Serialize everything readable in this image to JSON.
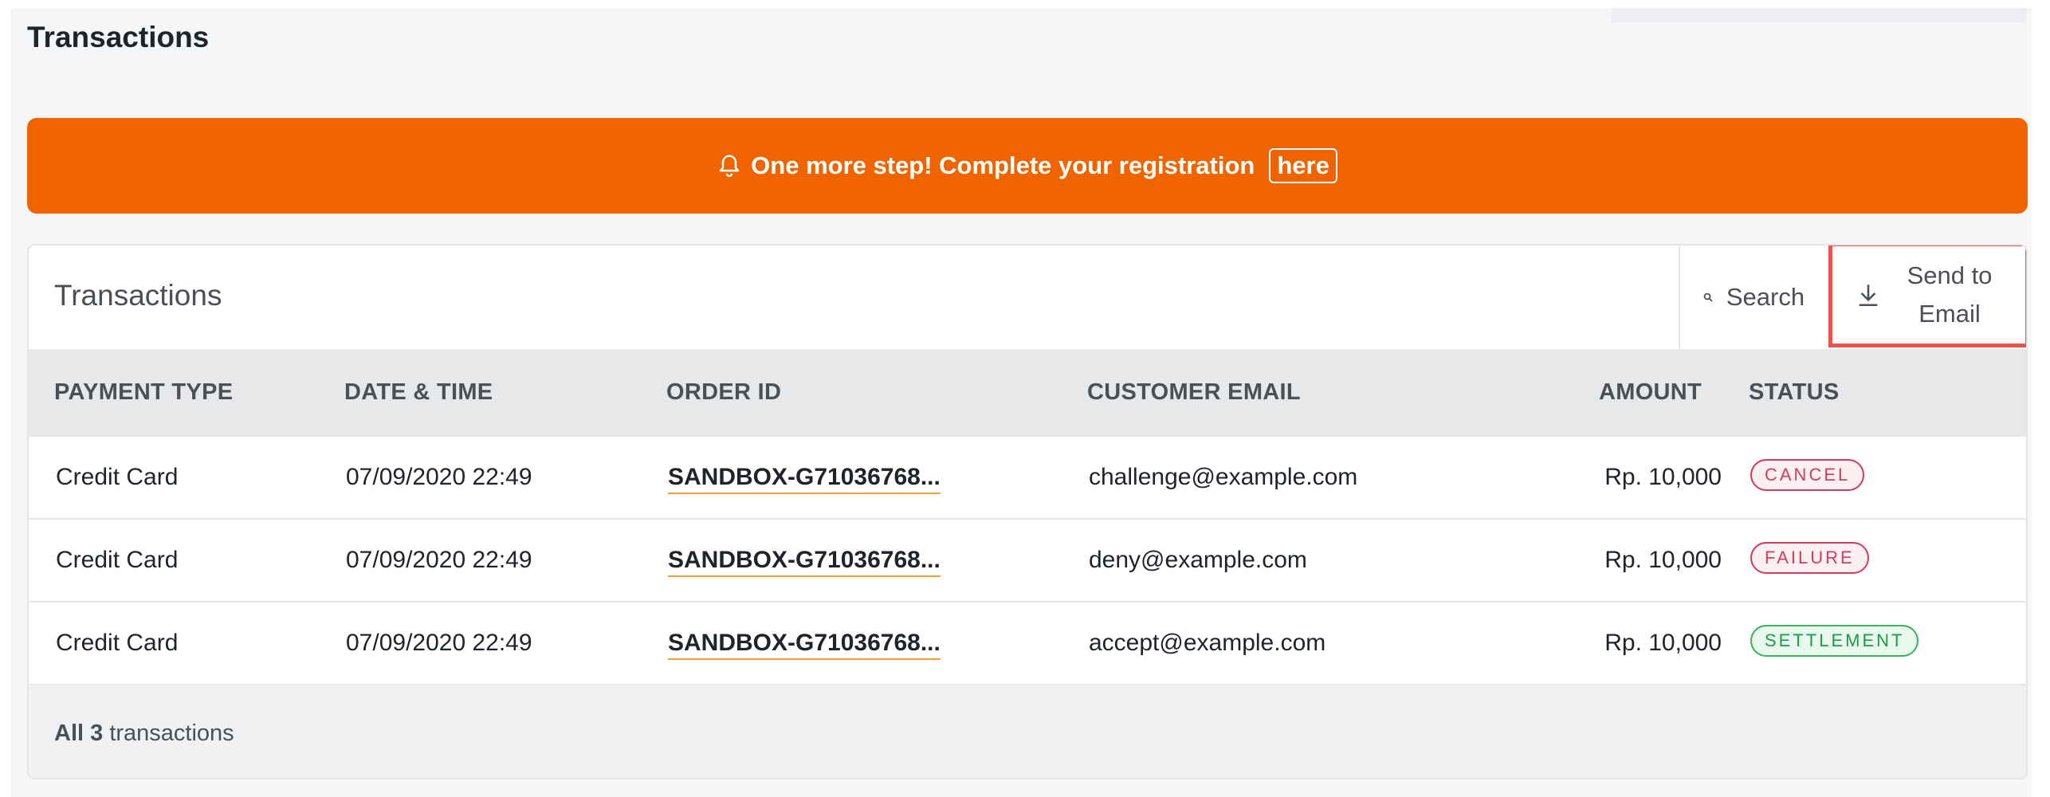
{
  "page": {
    "title": "Transactions"
  },
  "banner": {
    "icon": "bell-icon",
    "message": "One more step! Complete your registration",
    "link_label": "here",
    "color": "#f06400"
  },
  "card": {
    "title": "Transactions",
    "search_label": "Search",
    "search_icon": "search-icon",
    "send_label_line1": "Send to",
    "send_label_line2": "Email",
    "send_icon": "download-icon",
    "highlight_color": "#e8554b"
  },
  "table": {
    "headers": [
      "PAYMENT TYPE",
      "DATE & TIME",
      "ORDER ID",
      "CUSTOMER EMAIL",
      "AMOUNT",
      "STATUS"
    ],
    "rows": [
      {
        "payment_type": "Credit Card",
        "datetime": "07/09/2020 22:49",
        "order_id": "SANDBOX-G71036768...",
        "email": "challenge@example.com",
        "amount": "Rp. 10,000",
        "status": "CANCEL"
      },
      {
        "payment_type": "Credit Card",
        "datetime": "07/09/2020 22:49",
        "order_id": "SANDBOX-G71036768...",
        "email": "deny@example.com",
        "amount": "Rp. 10,000",
        "status": "FAILURE"
      },
      {
        "payment_type": "Credit Card",
        "datetime": "07/09/2020 22:49",
        "order_id": "SANDBOX-G71036768...",
        "email": "accept@example.com",
        "amount": "Rp. 10,000",
        "status": "SETTLEMENT"
      }
    ]
  },
  "footer": {
    "prefix": "All",
    "count": "3",
    "suffix": "transactions"
  },
  "status_colors": {
    "cancel": "#d23b5b",
    "failure": "#d23b5b",
    "settlement": "#1e9a46"
  }
}
